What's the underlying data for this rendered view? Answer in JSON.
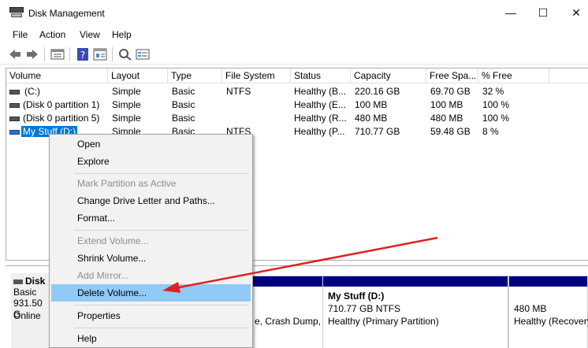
{
  "window": {
    "title": "Disk Management",
    "minimize_glyph": "—",
    "maximize_glyph": "☐",
    "close_glyph": "✕"
  },
  "menu": [
    "File",
    "Action",
    "View",
    "Help"
  ],
  "toolbar": {
    "icons": [
      "back-icon",
      "forward-icon",
      "list-view-icon",
      "help-icon",
      "properties-icon",
      "rescan-icon",
      "settings-icon"
    ]
  },
  "volume_list": {
    "columns": [
      "Volume",
      "Layout",
      "Type",
      "File System",
      "Status",
      "Capacity",
      "Free Spa...",
      "% Free"
    ],
    "rows": [
      {
        "volume": "(C:)",
        "layout": "Simple",
        "type": "Basic",
        "fs": "NTFS",
        "status": "Healthy (B...",
        "capacity": "220.16 GB",
        "free": "69.70 GB",
        "pct": "32 %"
      },
      {
        "volume": "(Disk 0 partition 1)",
        "layout": "Simple",
        "type": "Basic",
        "fs": "",
        "status": "Healthy (E...",
        "capacity": "100 MB",
        "free": "100 MB",
        "pct": "100 %"
      },
      {
        "volume": "(Disk 0 partition 5)",
        "layout": "Simple",
        "type": "Basic",
        "fs": "",
        "status": "Healthy (R...",
        "capacity": "480 MB",
        "free": "480 MB",
        "pct": "100 %"
      },
      {
        "volume": "My Stuff (D:)",
        "layout": "Simple",
        "type": "Basic",
        "fs": "NTFS",
        "status": "Healthy (P...",
        "capacity": "710.77 GB",
        "free": "59.48 GB",
        "pct": "8 %"
      }
    ]
  },
  "disk": {
    "name": "Disk",
    "type": "Basic",
    "size": "931.50 G",
    "state": "Online",
    "partitions": [
      {
        "line2": "e, Crash Dump,"
      },
      {
        "name": "My Stuff  (D:)",
        "size": "710.77 GB NTFS",
        "status": "Healthy (Primary Partition)"
      },
      {
        "size": "480 MB",
        "status": "Healthy (Recovery"
      }
    ]
  },
  "context_menu": {
    "items": [
      {
        "label": "Open",
        "disabled": false
      },
      {
        "label": "Explore",
        "disabled": false
      },
      {
        "label": "Mark Partition as Active",
        "disabled": true
      },
      {
        "label": "Change Drive Letter and Paths...",
        "disabled": false
      },
      {
        "label": "Format...",
        "disabled": false
      },
      {
        "label": "Extend Volume...",
        "disabled": true
      },
      {
        "label": "Shrink Volume...",
        "disabled": false
      },
      {
        "label": "Add Mirror...",
        "disabled": true
      },
      {
        "label": "Delete Volume...",
        "disabled": false,
        "highlighted": true
      },
      {
        "label": "Properties",
        "disabled": false
      },
      {
        "label": "Help",
        "disabled": false
      }
    ]
  },
  "colors": {
    "selection": "#0078d7",
    "menu_highlight": "#91c9f7",
    "partition_bar": "#00007f",
    "annotation_arrow": "#e02020"
  }
}
